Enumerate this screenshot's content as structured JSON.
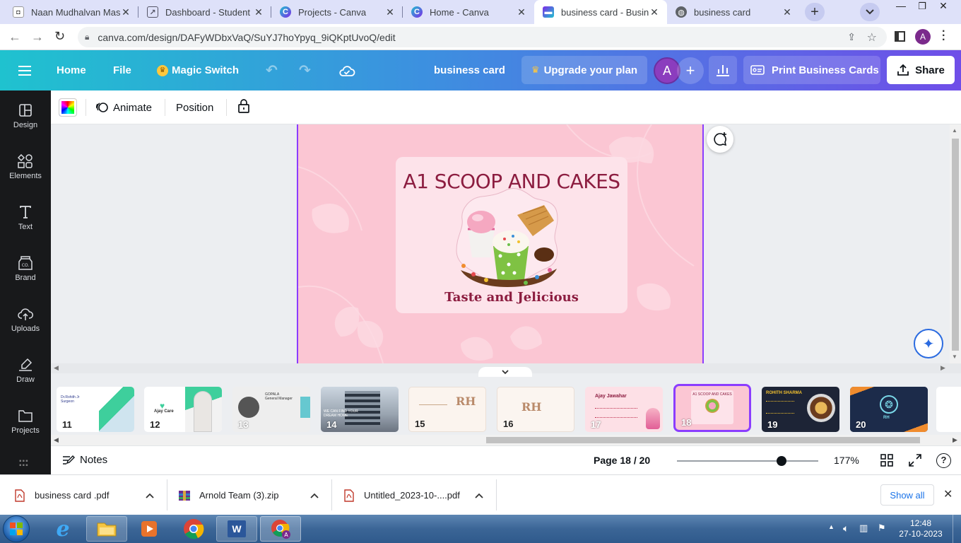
{
  "browser": {
    "tabs": [
      {
        "title": "Naan Mudhalvan Mass",
        "icon": "naan-mudhalvan-icon"
      },
      {
        "title": "Dashboard - Student",
        "icon": "dashboard-icon"
      },
      {
        "title": "Projects - Canva",
        "icon": "canva-icon"
      },
      {
        "title": "Home - Canva",
        "icon": "canva-icon"
      },
      {
        "title": "business card - Busines",
        "icon": "canva-doc-icon",
        "active": true
      },
      {
        "title": "business card",
        "icon": "globe-icon"
      }
    ],
    "url": "canva.com/design/DAFyWDbxVaQ/SuYJ7hoYpyq_9iQKptUvoQ/edit",
    "profile_initial": "A"
  },
  "canva_header": {
    "home": "Home",
    "file": "File",
    "magic_switch": "Magic Switch",
    "doc_title": "business card",
    "upgrade": "Upgrade your plan",
    "avatar_initial": "A",
    "print": "Print Business Cards",
    "share": "Share",
    "accent": "#8b3dff"
  },
  "sidebar": {
    "items": [
      {
        "label": "Design",
        "icon": "design-icon"
      },
      {
        "label": "Elements",
        "icon": "elements-icon"
      },
      {
        "label": "Text",
        "icon": "text-icon"
      },
      {
        "label": "Brand",
        "icon": "brand-icon"
      },
      {
        "label": "Uploads",
        "icon": "uploads-icon"
      },
      {
        "label": "Draw",
        "icon": "draw-icon"
      },
      {
        "label": "Projects",
        "icon": "projects-icon"
      }
    ]
  },
  "toolbar": {
    "animate": "Animate",
    "position": "Position"
  },
  "design": {
    "heading": "A1 SCOOP AND CAKES",
    "tagline": "Taste and Jelicious",
    "background": "#fbc6d3",
    "heading_color": "#8c1d40"
  },
  "filmstrip": {
    "pages": [
      {
        "num": "11",
        "text": "Dr.Rohith Jr\nSurgeon",
        "bg": "#ffffff"
      },
      {
        "num": "12",
        "text": "Ajay Care",
        "bg": "#ffffff"
      },
      {
        "num": "13",
        "text": "GOPALA\nGeneral Manager",
        "bg": "#eeeeee"
      },
      {
        "num": "14",
        "text": "WE CAN FIND YOUR DREAM HOME",
        "bg": "#c8d0d8"
      },
      {
        "num": "15",
        "text": "RH",
        "bg": "#fbf4ee"
      },
      {
        "num": "16",
        "text": "RH",
        "bg": "#fbf5f0"
      },
      {
        "num": "17",
        "text": "Ajay Jawahar",
        "bg": "#fde0e6"
      },
      {
        "num": "18",
        "text": "A1 SCOOP AND CAKES",
        "bg": "#fbc6d3",
        "selected": true
      },
      {
        "num": "19",
        "text": "ROHITH SHARMA",
        "bg": "#1d2436"
      },
      {
        "num": "20",
        "text": "RH",
        "bg": "#1c2b4a"
      }
    ]
  },
  "footer": {
    "notes": "Notes",
    "page_indicator": "Page 18 / 20",
    "zoom": "177%",
    "zoom_level": 0.74
  },
  "downloads": {
    "items": [
      {
        "name": "business card .pdf",
        "icon": "pdf-icon"
      },
      {
        "name": "Arnold Team (3).zip",
        "icon": "zip-icon"
      },
      {
        "name": "Untitled_2023-10-....pdf",
        "icon": "pdf-icon"
      }
    ],
    "show_all": "Show all"
  },
  "taskbar": {
    "time": "12:48",
    "date": "27-10-2023"
  }
}
